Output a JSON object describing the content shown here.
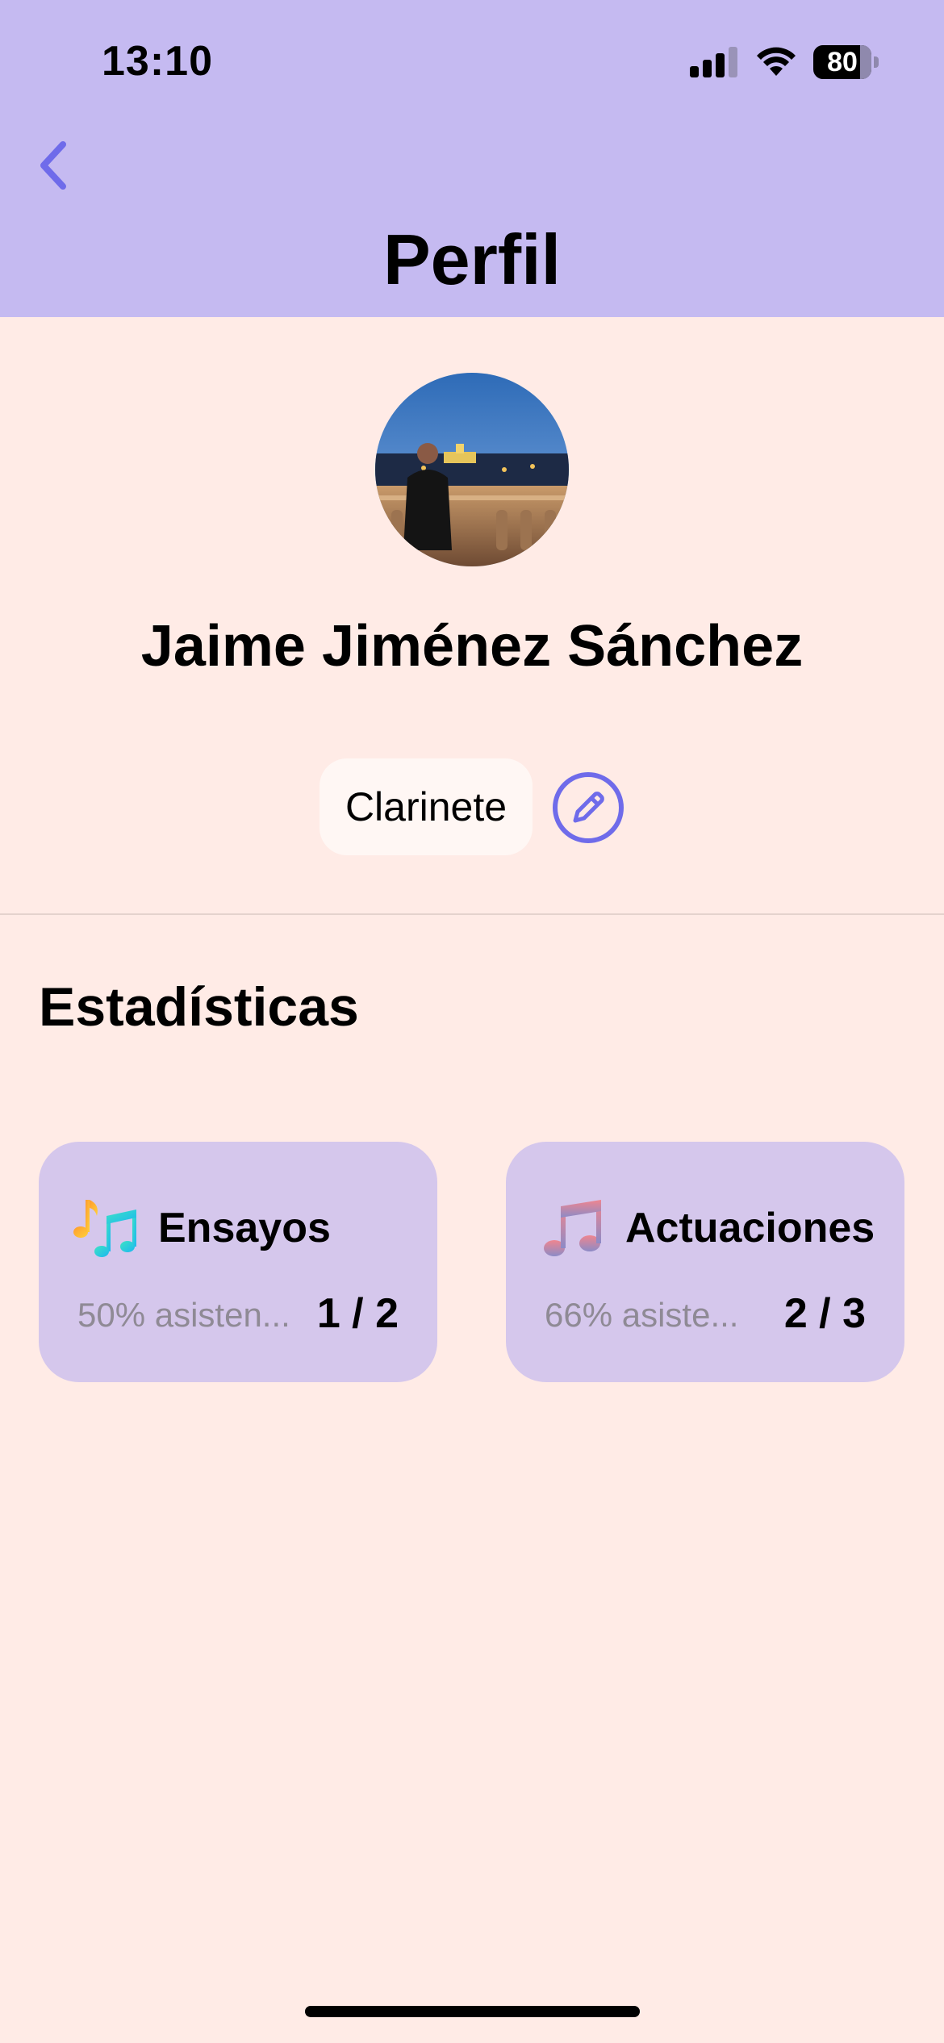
{
  "status_bar": {
    "time": "13:10",
    "battery": "80"
  },
  "header": {
    "title": "Perfil",
    "back_icon": "chevron-left-icon",
    "background_color": "#C5BAF1",
    "accent_color": "#6F6BEA"
  },
  "profile": {
    "name": "Jaime Jiménez Sánchez",
    "instrument": "Clarinete",
    "edit_icon": "pencil-icon"
  },
  "stats": {
    "section_title": "Estadísticas",
    "cards": [
      {
        "title": "Ensayos",
        "subtitle": "50% asisten...",
        "count": "1 / 2",
        "icon": "music-notes-colorful-icon"
      },
      {
        "title": "Actuaciones",
        "subtitle": "66% asiste...",
        "count": "2 / 3",
        "icon": "music-note-icon"
      }
    ]
  }
}
